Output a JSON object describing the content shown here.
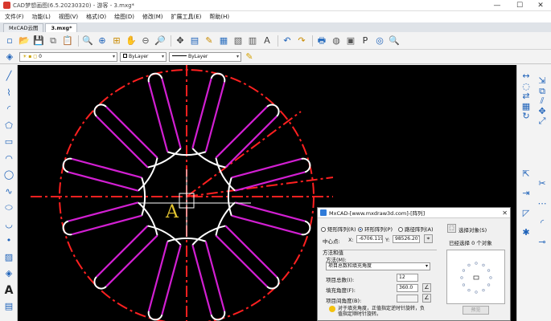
{
  "window": {
    "title": "CAD梦想画图(6.5.20230320) - 游客 - 3.mxg*",
    "controls": {
      "minimize": "—",
      "maximize": "☐",
      "close": "✕"
    }
  },
  "menu": [
    "文件(F)",
    "功能(L)",
    "视图(V)",
    "格式(O)",
    "绘图(D)",
    "修改(M)",
    "扩展工具(E)",
    "帮助(H)"
  ],
  "tabs": [
    {
      "label": "MxCAD云图",
      "active": false
    },
    {
      "label": "3.mxg*",
      "active": true
    }
  ],
  "tab_controls": {
    "menu": "▾",
    "close": "×"
  },
  "toolbar_icons": [
    "new-file-icon",
    "open-folder-icon",
    "save-icon",
    "copy-icon",
    "paste-icon",
    "magnifier-icon",
    "zoom-window-icon",
    "zoom-extents-icon",
    "pan-hand-icon",
    "zoom-previous-icon",
    "zoom-realtime-icon",
    "move-icon",
    "layer-state-icon",
    "match-properties-icon",
    "block-icon",
    "insert-block-icon",
    "table-icon",
    "text-style-icon",
    "undo-icon",
    "redo-icon",
    "print-icon",
    "web-globe-icon",
    "image-icon",
    "pdf-icon",
    "earth-icon",
    "search-icon"
  ],
  "toolbar_glyphs": [
    "▫",
    "📂",
    "💾",
    "⧉",
    "📋",
    "🔍",
    "⊕",
    "⊞",
    "✋",
    "⊖",
    "🔎",
    "✥",
    "▤",
    "✎",
    "▦",
    "▧",
    "▥",
    "Ａ",
    "↶",
    "↷",
    "🖶",
    "◍",
    "▣",
    "P",
    "◎",
    "🔍"
  ],
  "layer_bar": {
    "layer_value": "0",
    "color_value": "ByLayer",
    "linetype_value": "ByLayer",
    "lineweight_value": "ByLayer"
  },
  "left_tools": [
    "line-icon",
    "polyline-icon",
    "arc-icon",
    "polygon-icon",
    "rectangle-icon",
    "arc2-icon",
    "circle-icon",
    "spline-icon",
    "ellipse-icon",
    "ellipse-arc-icon",
    "point-icon",
    "hatch-icon",
    "region-icon",
    "text-icon",
    "mtext-icon"
  ],
  "left_glyphs": [
    "╱",
    "⌇",
    "◜",
    "⬠",
    "▭",
    "◠",
    "◯",
    "∿",
    "⬭",
    "◡",
    "•",
    "▨",
    "◈",
    "A",
    "▤"
  ],
  "right_tools": [
    "dimension-icon",
    "align-icon",
    "erase-icon",
    "copy2-icon",
    "mirror-icon",
    "offset-icon",
    "array-icon",
    "move2-icon",
    "rotate-icon",
    "scale-icon",
    "stretch-icon",
    "trim-icon",
    "extend-icon",
    "break-icon",
    "chamfer-icon",
    "fillet-icon",
    "explode-icon",
    "join-icon"
  ],
  "right_glyphs": [
    "↔",
    "⇲",
    "◌",
    "⧉",
    "⇄",
    "⫽",
    "▦",
    "✥",
    "↻",
    "⤢",
    "⇱",
    "✂",
    "⇥",
    "⋯",
    "◸",
    "◜",
    "✱",
    "⊸"
  ],
  "canvas": {
    "label_text": "A",
    "background": "#000000",
    "centerline_color": "#ff2020",
    "slot_color": "#d21fd2",
    "arc_color": "#ffffff",
    "label_color": "#e3c430"
  },
  "dialog": {
    "title": "MxCAD-[www.mxdraw3d.com]-[阵列]",
    "close": "✕",
    "radio_rect": "矩形阵列(R)",
    "radio_polar": "环形阵列(P)",
    "radio_path": "路径阵列(A)",
    "select_objects": "选择对象(S)",
    "selected_count": "已经选择 0 个对象",
    "center_label": "中心点:",
    "x_label": "X:",
    "x_value": "-6706.119",
    "y_label": "Y:",
    "y_value": "98526.207",
    "method_group": "方法和值",
    "method_label": "方法(M):",
    "method_value": "项目总数和填充角度",
    "total_label": "项目总数(I):",
    "total_value": "12",
    "fill_label": "填充角度(F):",
    "fill_value": "360.0",
    "between_label": "项目间角度(B):",
    "between_value": "",
    "notice": "对于填充角度，正值指定逆时针旋转，负值指定顺时针旋转。",
    "preview_button": "预览"
  }
}
